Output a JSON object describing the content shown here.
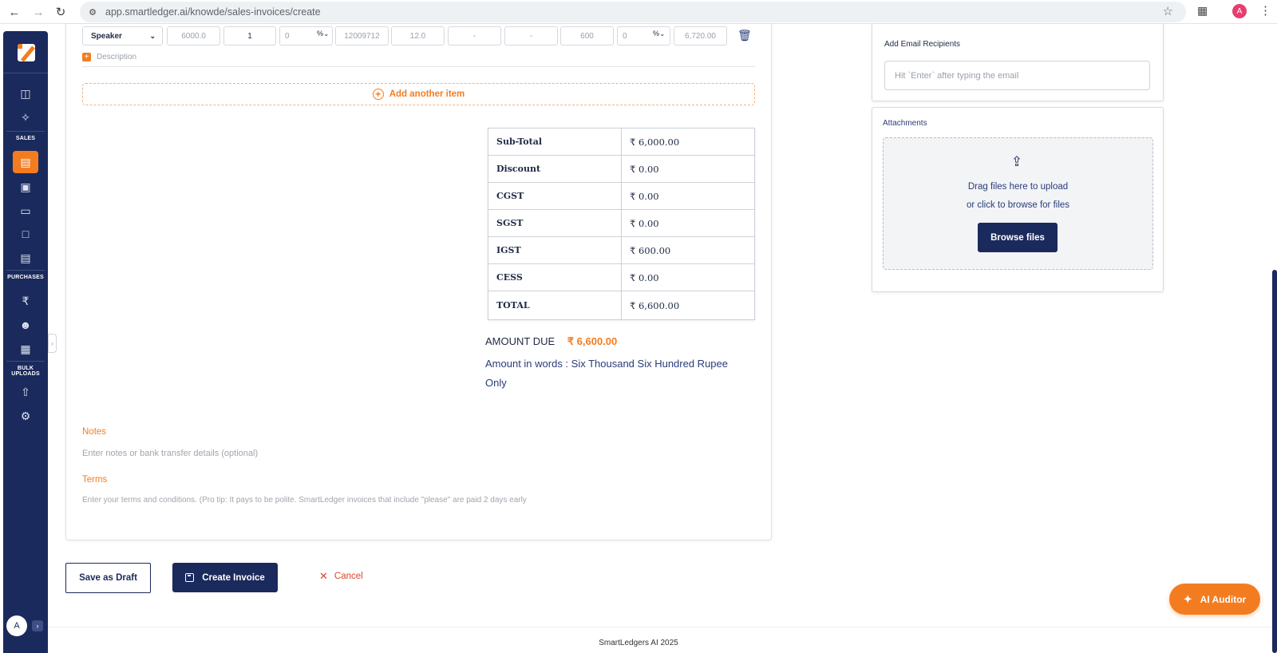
{
  "browser": {
    "url": "app.smartledger.ai/knowde/sales-invoices/create",
    "profile_initial": "A"
  },
  "sidebar": {
    "sections": {
      "sales": "SALES",
      "purchases": "PURCHASES",
      "bulk_uploads": "BULK UPLOADS"
    },
    "user_initial": "A"
  },
  "item_row": {
    "item_name": "Speaker",
    "rate": "6000.0",
    "quantity": "1",
    "discount": "0",
    "discount_unit": "%",
    "hsn": "12009712",
    "tax_rate": "12.0",
    "cgst": "-",
    "sgst": "-",
    "igst": "600",
    "cess": "0",
    "cess_unit": "%",
    "amount": "6,720.00",
    "description_label": "Description"
  },
  "add_item_label": "Add another item",
  "totals": [
    {
      "label": "Sub-Total",
      "value": "₹ 6,000.00"
    },
    {
      "label": "Discount",
      "value": "₹ 0.00"
    },
    {
      "label": "CGST",
      "value": "₹ 0.00"
    },
    {
      "label": "SGST",
      "value": "₹ 0.00"
    },
    {
      "label": "IGST",
      "value": "₹ 600.00"
    },
    {
      "label": "CESS",
      "value": "₹ 0.00"
    },
    {
      "label": "TOTAL",
      "value": "₹ 6,600.00"
    }
  ],
  "amount_due": {
    "label": "AMOUNT DUE",
    "value": "₹ 6,600.00",
    "in_words": "Amount in words : Six Thousand Six Hundred Rupee Only"
  },
  "notes": {
    "label": "Notes",
    "placeholder": "Enter notes or bank transfer details (optional)"
  },
  "terms": {
    "label": "Terms",
    "placeholder": "Enter your terms and conditions. (Pro tip: It pays to be polite. SmartLedger invoices that include \"please\" are paid 2 days early"
  },
  "actions": {
    "save_draft": "Save as Draft",
    "create_invoice": "Create Invoice",
    "cancel": "Cancel"
  },
  "email": {
    "title": "Add Email Recipients",
    "placeholder": "Hit `Enter` after typing the email"
  },
  "attachments": {
    "title": "Attachments",
    "drag_text": "Drag files here to upload",
    "browse_text": "or click to browse for files",
    "browse_button": "Browse files"
  },
  "ai_auditor_label": "AI Auditor",
  "footer": "SmartLedgers AI 2025",
  "colors": {
    "primary": "#1b2a5c",
    "accent": "#f47c20",
    "danger": "#e0452b"
  }
}
